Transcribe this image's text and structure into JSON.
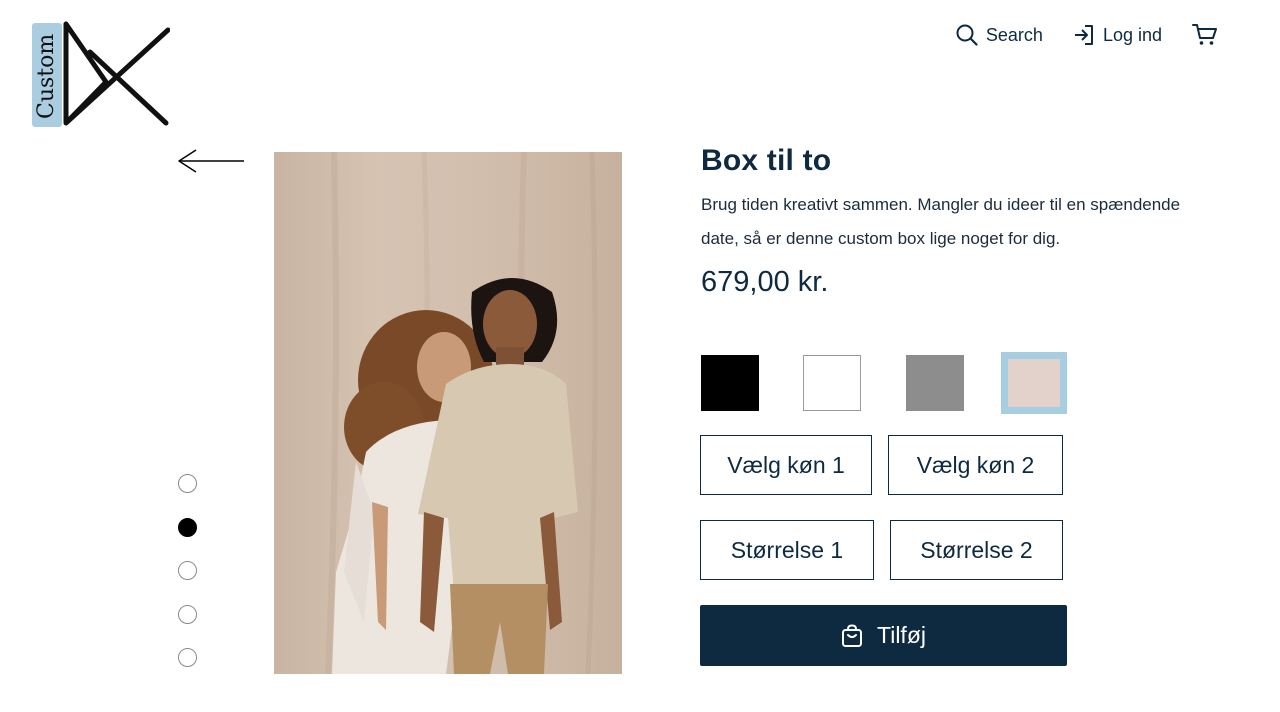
{
  "logo": {
    "text": "Custom"
  },
  "nav": {
    "search_label": "Search",
    "login_label": "Log ind"
  },
  "icons": {
    "search": "search-icon",
    "login": "login-icon",
    "cart": "cart-icon",
    "back": "arrow-left-icon",
    "bag": "shopping-bag-icon"
  },
  "gallery": {
    "image_count": 5,
    "active_index": 1
  },
  "product": {
    "title": "Box til to",
    "description": "Brug tiden kreativt sammen. Mangler du ideer til en spændende date, så er denne custom box lige noget for dig.",
    "price": "679,00 kr.",
    "colors": [
      {
        "name": "black",
        "hex": "#000000"
      },
      {
        "name": "white",
        "hex": "#ffffff"
      },
      {
        "name": "grey",
        "hex": "#8d8d8d"
      },
      {
        "name": "pink",
        "hex": "#e3d2cc",
        "selected": true,
        "selected_border": "#a6cde0"
      }
    ],
    "gender_options": [
      "Vælg køn 1",
      "Vælg køn 2"
    ],
    "size_options": [
      "Størrelse 1",
      "Størrelse 2"
    ],
    "add_button_label": "Tilføj"
  },
  "theme": {
    "primary": "#0e2a40",
    "accent": "#9cc4dc"
  }
}
